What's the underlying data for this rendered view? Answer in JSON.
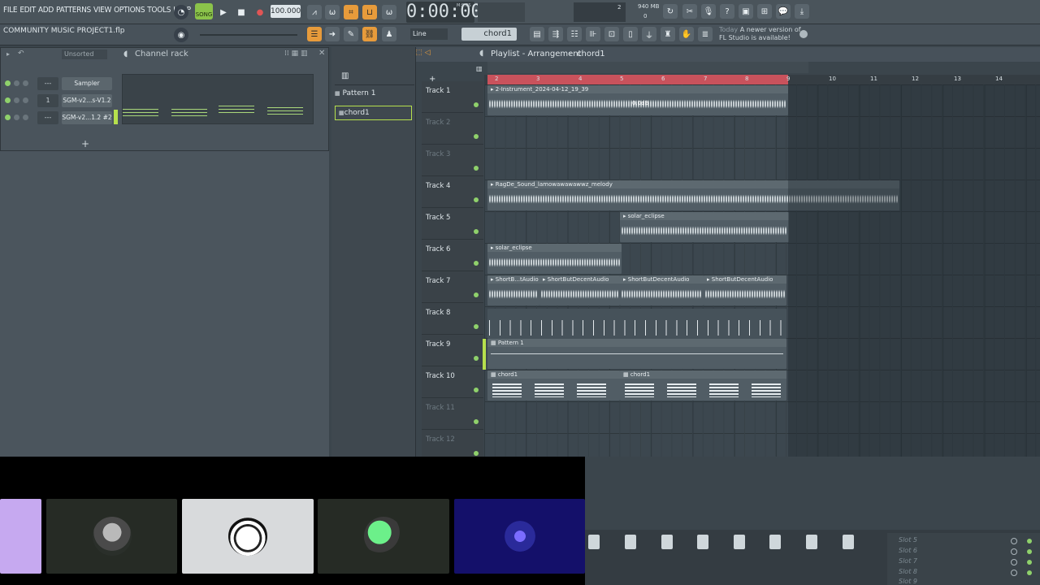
{
  "menu": [
    "FILE",
    "EDIT",
    "ADD",
    "PATTERNS",
    "VIEW",
    "OPTIONS",
    "TOOLS",
    "HELP"
  ],
  "transport": {
    "song_label": "SONG",
    "tempo": "100.000",
    "time": "0:00:00",
    "time_unit": "M:S:CS",
    "memory": "940 MB",
    "cpu": "2",
    "voices": "0"
  },
  "project": {
    "name": "COMMUNITY MUSIC PROJECT1.flp"
  },
  "toolbar": {
    "snap": "Line",
    "pattern": "chord1",
    "news_day": "Today",
    "news_text": "A newer version of",
    "news_text2": "FL Studio is available!"
  },
  "channel_rack": {
    "title": "Channel rack",
    "filter": "Unsorted",
    "add": "+",
    "channels": [
      {
        "num": "---",
        "name": "Sampler"
      },
      {
        "num": "1",
        "name": "SGM-v2...s-V1.2"
      },
      {
        "num": "---",
        "name": "SGM-v2...1.2 #2"
      }
    ]
  },
  "picker": {
    "items": [
      "Pattern 1",
      "chord1"
    ]
  },
  "playlist": {
    "title": "Playlist - Arrangement",
    "crumb": "chord1",
    "bar_numbers": [
      "2",
      "3",
      "4",
      "5",
      "6",
      "7",
      "8",
      "9",
      "10",
      "11",
      "12",
      "13",
      "14"
    ],
    "tracks": [
      "Track 1",
      "Track 2",
      "Track 3",
      "Track 4",
      "Track 5",
      "Track 6",
      "Track 7",
      "Track 8",
      "Track 9",
      "Track 10",
      "Track 11",
      "Track 12"
    ],
    "clips": {
      "c1": "2-Instrument_2024-04-12_19_39",
      "c1_gain": "0.0dB",
      "c4": "RagDe_Sound_lamowawawawwz_melody",
      "c5": "solar_eclipse",
      "c6": "solar_eclipse",
      "c7a": "ShortB...tAudio",
      "c7b": "ShortButDecentAudio",
      "c7c": "ShortButDecentAudio",
      "c7d": "ShortButDecentAudio",
      "c9": "Pattern 1",
      "c10a": "chord1",
      "c10b": "chord1"
    }
  },
  "mixer": {
    "slots": [
      "Slot 5",
      "Slot 6",
      "Slot 7",
      "Slot 8",
      "Slot 9"
    ]
  },
  "colors": {
    "accent": "#e79b3b",
    "loop": "#c9525c",
    "led": "#8fd16b",
    "song": "#8bc34a"
  }
}
